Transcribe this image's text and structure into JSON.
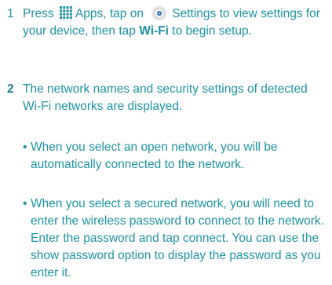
{
  "steps": [
    {
      "number": "1",
      "part1": "Press",
      "part2": "Apps, tap on",
      "part3": "Settings to view settings for your device, then tap",
      "bold_term": "Wi-Fi",
      "part4": "to begin setup."
    },
    {
      "number": "2",
      "text": "The network names and security settings of detected Wi-Fi networks are displayed."
    }
  ],
  "bullets": [
    "When you select an open network, you will be automatically connected to the network.",
    "When you select a secured network, you will need to enter the wireless password to connect to the network. Enter the password and tap connect. You can use the show password option to display the password as you enter it."
  ],
  "bullet_symbol": "•",
  "icons": {
    "apps": "apps-grid-icon",
    "settings": "settings-gear-icon"
  },
  "colors": {
    "text": "#1f93a4",
    "apps_icon": "#1a8fa0",
    "settings_ring": "#e4e4e4",
    "settings_center": "#2e6fb0"
  }
}
